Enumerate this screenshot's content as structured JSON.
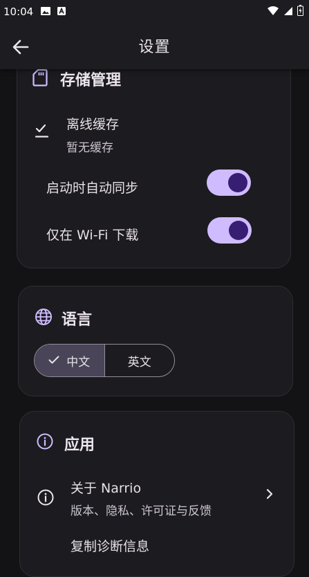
{
  "status_bar": {
    "time": "10:04"
  },
  "app_bar": {
    "title": "设置"
  },
  "storage": {
    "title": "存储管理",
    "offline_cache": {
      "title": "离线缓存",
      "subtitle": "暂无缓存"
    },
    "auto_sync": {
      "label": "启动时自动同步",
      "enabled": true
    },
    "wifi_only": {
      "label": "仅在 Wi-Fi 下载",
      "enabled": true
    }
  },
  "language": {
    "title": "语言",
    "options": [
      "中文",
      "英文"
    ],
    "selected": "中文"
  },
  "app": {
    "title": "应用",
    "about": {
      "title": "关于 Narrio",
      "subtitle": "版本、隐私、许可证与反馈"
    },
    "copy_diagnostics": {
      "title": "复制诊断信息"
    }
  },
  "colors": {
    "accent": "#cfbcff",
    "knob": "#381e72",
    "background": "#131316",
    "card": "#1c1b1f"
  }
}
